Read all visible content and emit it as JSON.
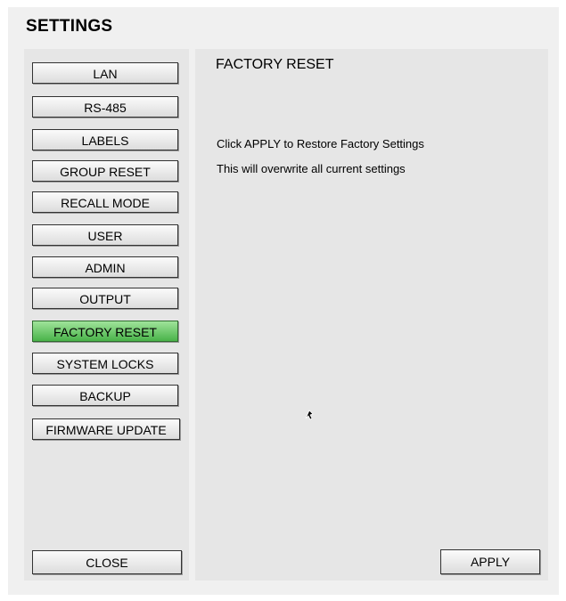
{
  "window": {
    "title": "SETTINGS"
  },
  "sidebar": {
    "items": [
      {
        "label": "LAN"
      },
      {
        "label": "RS-485"
      },
      {
        "label": "LABELS"
      },
      {
        "label": "GROUP RESET"
      },
      {
        "label": "RECALL MODE"
      },
      {
        "label": "USER"
      },
      {
        "label": "ADMIN"
      },
      {
        "label": "OUTPUT"
      },
      {
        "label": "FACTORY RESET",
        "active": true
      },
      {
        "label": "SYSTEM LOCKS"
      },
      {
        "label": "BACKUP"
      },
      {
        "label": "FIRMWARE UPDATE"
      }
    ],
    "close_label": "CLOSE"
  },
  "main": {
    "section_title": "FACTORY RESET",
    "line1": "Click APPLY to Restore Factory Settings",
    "line2": "This will overwrite all current settings",
    "apply_label": "APPLY"
  },
  "colors": {
    "active_button": "#5cc05a",
    "panel_background": "#e6e6e6"
  }
}
